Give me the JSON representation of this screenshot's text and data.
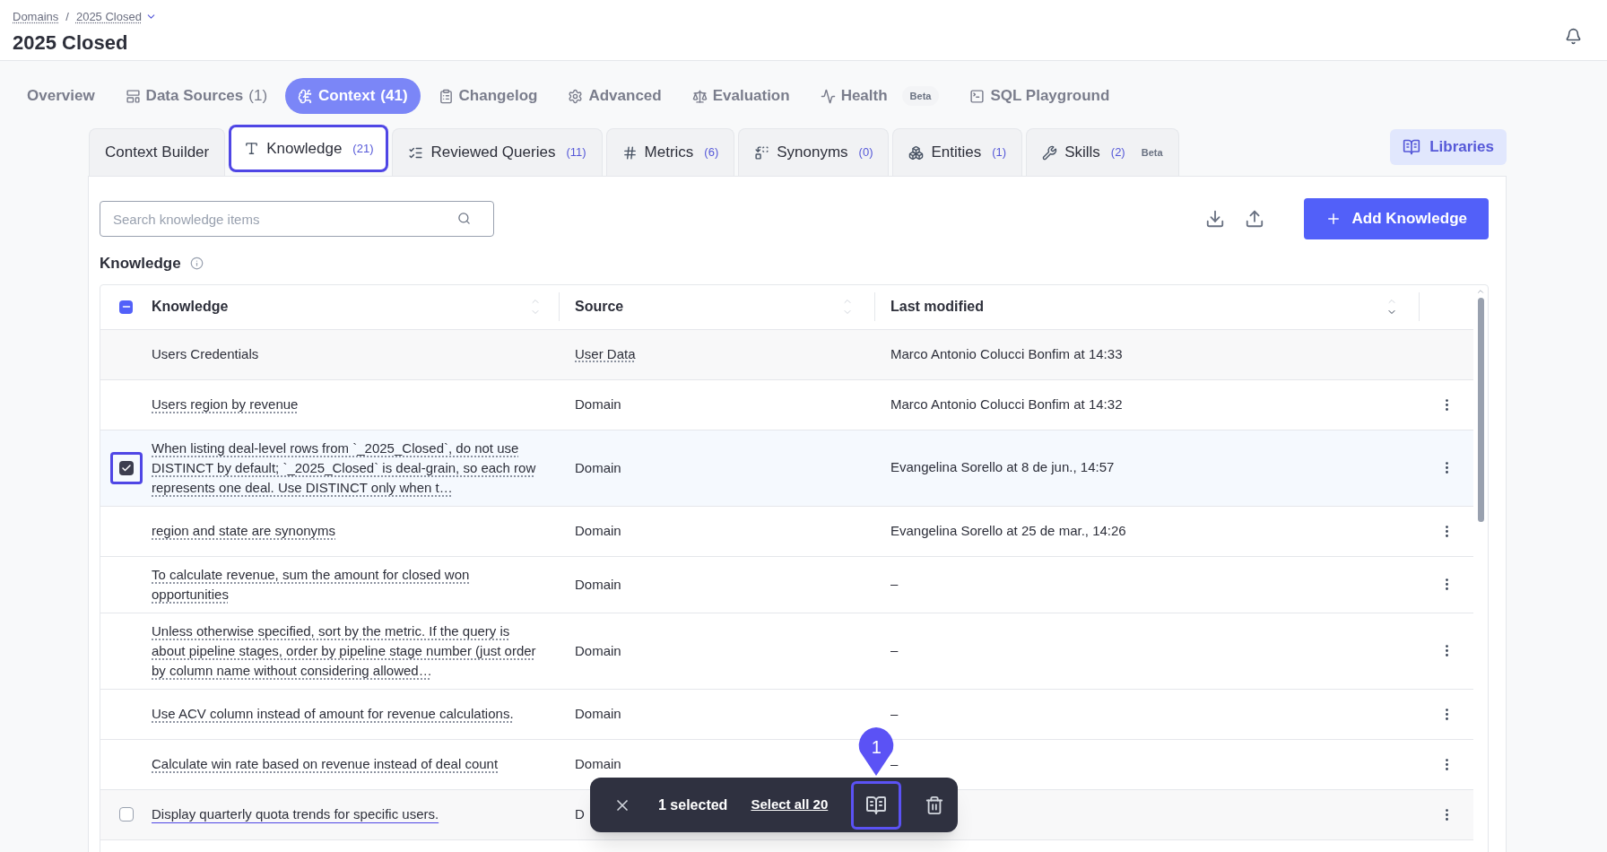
{
  "breadcrumb": {
    "items": [
      {
        "label": "Domains"
      },
      {
        "label": "2025 Closed"
      }
    ],
    "separator": "/"
  },
  "title": "2025 Closed",
  "main_tabs": [
    {
      "label": "Overview",
      "selected": false
    },
    {
      "label": "Data Sources",
      "count": "(1)",
      "selected": false
    },
    {
      "label": "Context",
      "count": "(41)",
      "selected": true
    },
    {
      "label": "Changelog",
      "selected": false
    },
    {
      "label": "Advanced",
      "selected": false
    },
    {
      "label": "Evaluation",
      "selected": false
    },
    {
      "label": "Health",
      "badge": "Beta",
      "selected": false
    },
    {
      "label": "SQL Playground",
      "selected": false
    }
  ],
  "sub_tabs": [
    {
      "label": "Context Builder",
      "selected": false
    },
    {
      "label": "Knowledge",
      "count": "(21)",
      "selected": true
    },
    {
      "label": "Reviewed Queries",
      "count": "(11)",
      "selected": false
    },
    {
      "label": "Metrics",
      "count": "(6)",
      "selected": false
    },
    {
      "label": "Synonyms",
      "count": "(0)",
      "selected": false
    },
    {
      "label": "Entities",
      "count": "(1)",
      "selected": false
    },
    {
      "label": "Skills",
      "count": "(2)",
      "badge": "Beta",
      "selected": false
    }
  ],
  "libraries_button": "Libraries",
  "search": {
    "placeholder": "Search knowledge items"
  },
  "add_button": "Add Knowledge",
  "section_title": "Knowledge",
  "table": {
    "header_checkbox_indeterminate": true,
    "columns": [
      {
        "label": "Knowledge",
        "sorted_desc": false
      },
      {
        "label": "Source",
        "sorted_desc": false
      },
      {
        "label": "Last modified",
        "sorted_desc": true
      }
    ],
    "rows": [
      {
        "knowledge": "Users Credentials",
        "source": "User Data",
        "source_link": true,
        "last_modified": "Marco Antonio Colucci Bonfim at 14:33",
        "read_only": true,
        "selected": false,
        "hovered": false
      },
      {
        "knowledge": "Users region by revenue",
        "source": "Domain",
        "source_link": false,
        "last_modified": "Marco Antonio Colucci Bonfim at 14:32",
        "read_only": false,
        "selected": false,
        "hovered": false
      },
      {
        "knowledge": "When listing deal-level rows from `_2025_Closed`, do not use DISTINCT by default; `_2025_Closed` is deal-grain, so each row represents one deal. Use DISTINCT only when t…",
        "source": "Domain",
        "source_link": false,
        "last_modified": "Evangelina Sorello at 8 de jun., 14:57",
        "read_only": false,
        "selected": true,
        "hovered": false
      },
      {
        "knowledge": "region and state are synonyms",
        "source": "Domain",
        "source_link": false,
        "last_modified": "Evangelina Sorello at 25 de mar., 14:26",
        "read_only": false,
        "selected": false,
        "hovered": false
      },
      {
        "knowledge": "To calculate revenue, sum the amount for closed won opportunities",
        "source": "Domain",
        "source_link": false,
        "last_modified": "–",
        "read_only": false,
        "selected": false,
        "hovered": false
      },
      {
        "knowledge": "Unless otherwise specified, sort by the metric. If the query is about pipeline stages, order by pipeline stage number (just order by column name without considering allowed…",
        "source": "Domain",
        "source_link": false,
        "last_modified": "–",
        "read_only": false,
        "selected": false,
        "hovered": false
      },
      {
        "knowledge": "Use ACV column instead of amount for revenue calculations.",
        "source": "Domain",
        "source_link": false,
        "last_modified": "–",
        "read_only": false,
        "selected": false,
        "hovered": false
      },
      {
        "knowledge": "Calculate win rate based on revenue instead of deal count",
        "source": "Domain",
        "source_link": false,
        "last_modified": "–",
        "read_only": false,
        "selected": false,
        "hovered": false
      },
      {
        "knowledge": "Display quarterly quota trends for specific users.",
        "source": "D",
        "source_link": false,
        "read_only": false,
        "selected": false,
        "hovered": true
      }
    ]
  },
  "selection_bar": {
    "count": "1 selected",
    "select_all": "Select all 20",
    "pin": "1"
  }
}
